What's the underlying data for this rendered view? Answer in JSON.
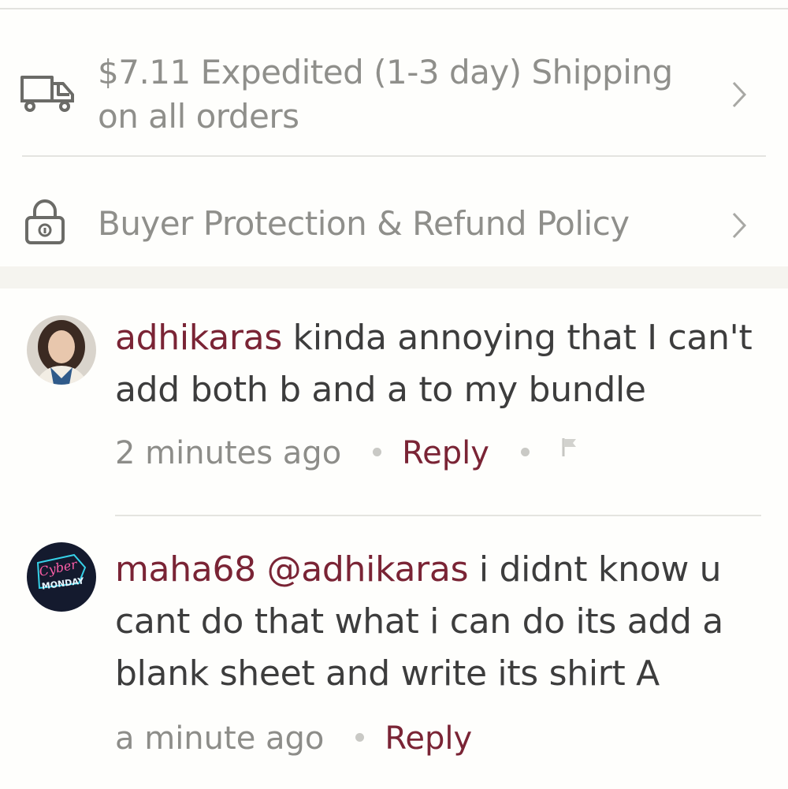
{
  "shipping": {
    "text": "$7.11 Expedited (1-3 day) Shipping on all orders",
    "icon": "truck-icon"
  },
  "protection": {
    "text": "Buyer Protection & Refund Policy",
    "icon": "lock-icon"
  },
  "comments": [
    {
      "username": "adhikaras",
      "text": "kinda annoying that I can't add both b and a to my bundle",
      "time": "2 minutes ago",
      "reply_label": "Reply",
      "avatar": "user-photo-avatar"
    },
    {
      "username": "maha68",
      "mention": "@adhikaras",
      "text": "i didnt know u cant do that what i can do its add a blank sheet and write its shirt A",
      "time": "a minute ago",
      "reply_label": "Reply",
      "avatar": "cyber-monday-avatar",
      "avatar_text_top": "Cyber",
      "avatar_text_bottom": "MONDAY"
    }
  ],
  "colors": {
    "accent": "#7a2435",
    "muted_text": "#8f8f8b",
    "band": "#f5f4ef"
  }
}
